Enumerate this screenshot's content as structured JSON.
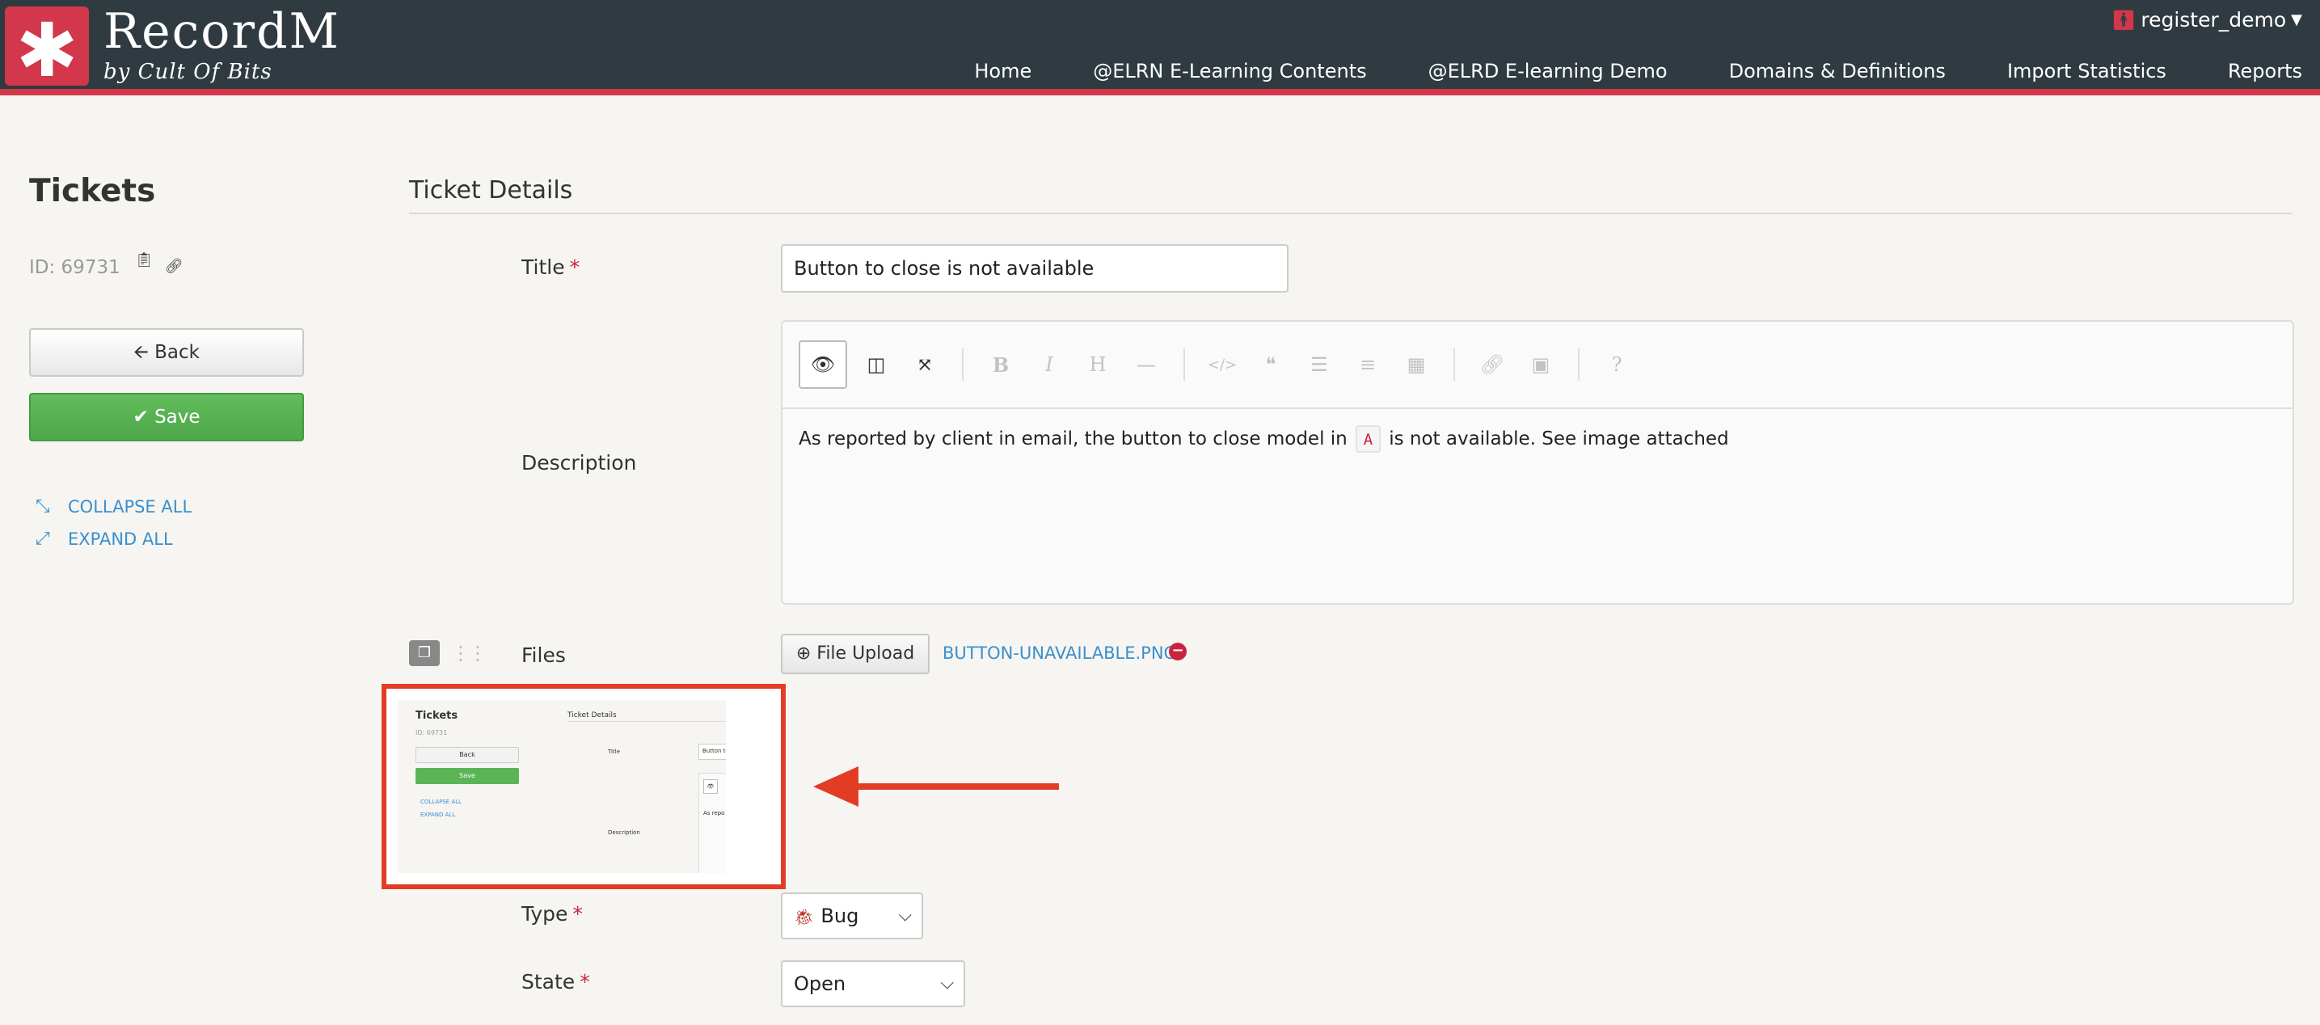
{
  "header": {
    "brand": "RecordM",
    "subtitle": "by Cult Of Bits",
    "logo_glyph": "✱",
    "user": "register_demo",
    "nav": [
      "Home",
      "@ELRN E-Learning Contents",
      "@ELRD E-learning Demo",
      "Domains & Definitions",
      "Import Statistics",
      "Reports"
    ]
  },
  "sidebar": {
    "title": "Tickets",
    "id_text": "ID: 69731",
    "back_label": "Back",
    "save_label": "Save",
    "collapse_label": "COLLAPSE ALL",
    "expand_label": "EXPAND ALL"
  },
  "form": {
    "section_title": "Ticket Details",
    "title_label": "Title",
    "title_value": "Button to close is not available",
    "description_label": "Description",
    "description_before": "As reported by client in email, the button to close model in",
    "description_code": "A",
    "description_after": "is not available. See image attached",
    "files_label": "Files",
    "upload_label": "File Upload",
    "file_name": "BUTTON-UNAVAILABLE.PNG",
    "type_label": "Type",
    "type_value": "Bug",
    "state_label": "State",
    "state_value": "Open",
    "required_mark": "*"
  },
  "thumbnail": {
    "title": "Tickets",
    "id_text": "ID: 69731",
    "back": "Back",
    "save": "Save",
    "collapse": "COLLAPSE ALL",
    "expand": "EXPAND ALL",
    "section": "Ticket Details",
    "title_label": "Title",
    "title_value": "Button to",
    "description_label": "Description",
    "description_text": "As repo"
  },
  "colors": {
    "header_bg": "#2f3b40",
    "brand_red": "#d2374b",
    "save_green": "#5bb557",
    "link_blue": "#3a8fcc",
    "annotation_red": "#e23d24"
  }
}
